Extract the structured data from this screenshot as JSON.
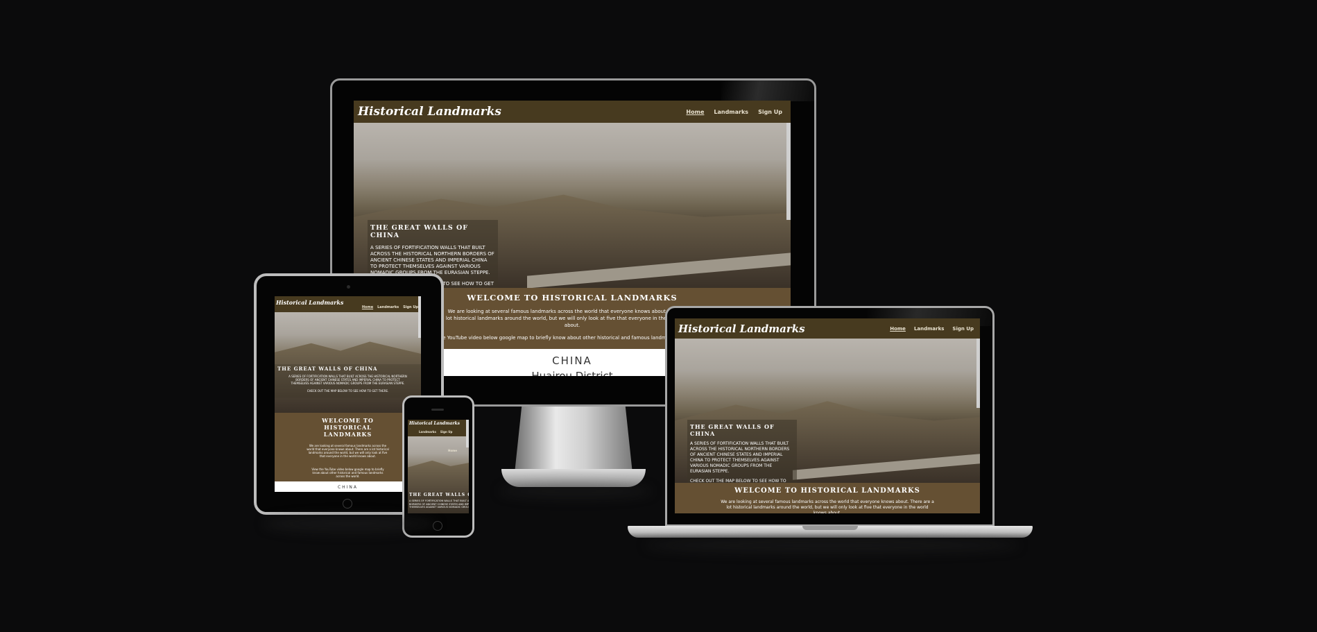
{
  "site": {
    "brand": "Historical Landmarks",
    "nav": {
      "home": "Home",
      "landmarks": "Landmarks",
      "signup": "Sign Up"
    },
    "hero": {
      "title": "THE GREAT WALLS OF CHINA",
      "text": "A SERIES OF FORTIFICATION WALLS THAT BUILT ACROSS THE HISTORICAL NORTHERN BORDERS OF ANCIENT CHINESE STATES AND IMPERIAL CHINA TO PROTECT THEMSELVES AGAINST VARIOUS NOMADIC GROUPS FROM THE EURASIAN STEPPE.",
      "cta": "CHECK OUT THE MAP BELOW TO SEE HOW TO GET THERE."
    },
    "welcome": {
      "title": "WELCOME TO HISTORICAL LANDMARKS",
      "p1": "We are looking at several famous landmarks across the world that everyone knows about. There are a lot historical landmarks around the world, but we will only look at five that everyone in the world knows about.",
      "p2": "View the YouTube video below google map to briefly know about other historical and famous landmarks across the world."
    },
    "section": {
      "country": "CHINA",
      "district": "Huairou District"
    }
  },
  "colors": {
    "background": "#0b0b0c",
    "nav": "#473a1f",
    "welcome": "#655033",
    "device_frame": "#050505",
    "silver": "#cfcfcf"
  },
  "icons": {
    "home_button": "circle-home-button-icon",
    "camera": "camera-dot-icon"
  }
}
